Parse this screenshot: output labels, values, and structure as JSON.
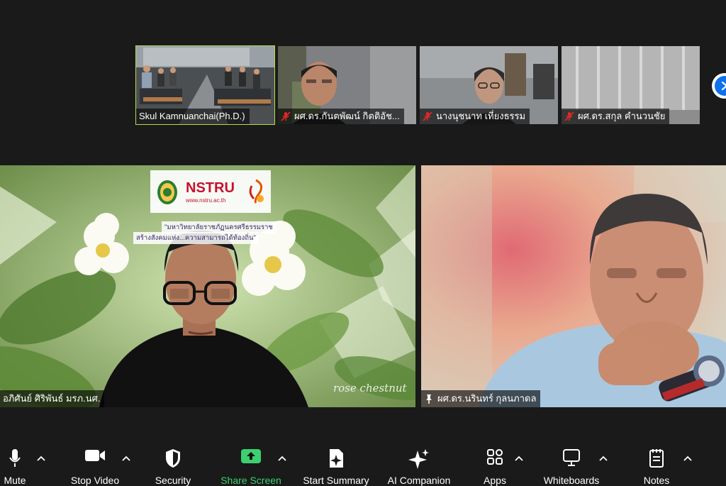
{
  "gallery": {
    "thumbnails": [
      {
        "name": "Skul Kamnuanchai(Ph.D.)",
        "muted": false
      },
      {
        "name": "ผศ.ดร.กันตพัฒน์ กิตติอัช...",
        "muted": true
      },
      {
        "name": "นางนุชนาท เที่ยงธรรม",
        "muted": true
      },
      {
        "name": "ผศ.ดร.สกุล  คำนวนชัย",
        "muted": true
      }
    ]
  },
  "main": {
    "left": {
      "name": "อภิศันย์  ศิริพันธ์ มรภ.นศ.",
      "background": {
        "logo_text": "NSTRU",
        "logo_url": "www.nstru.ac.th",
        "slogan_line1": "\"มหาวิทยาลัยราชภัฏนครศรีธรรมราช",
        "slogan_line2": "สร้างสังคมแห่ง...ความสามารถได้ท้องถิ่น\"",
        "script_text": "rose chestnut"
      }
    },
    "right": {
      "name": "ผศ.ดร.นรินทร์ กุลนภาดล",
      "pinned": true
    }
  },
  "toolbar": {
    "items": [
      {
        "label": "Mute",
        "icon": "microphone-icon"
      },
      {
        "label": "Stop Video",
        "icon": "video-camera-icon"
      },
      {
        "label": "Security",
        "icon": "shield-icon"
      },
      {
        "label": "Share Screen",
        "icon": "share-screen-icon"
      },
      {
        "label": "Start Summary",
        "icon": "summary-icon"
      },
      {
        "label": "AI Companion",
        "icon": "sparkle-icon"
      },
      {
        "label": "Apps",
        "icon": "apps-icon"
      },
      {
        "label": "Whiteboards",
        "icon": "whiteboard-icon"
      },
      {
        "label": "Notes",
        "icon": "notes-icon"
      }
    ]
  },
  "colors": {
    "background": "#1a1a1a",
    "active_speaker_border": "#b6d94a",
    "share_green": "#3cd070",
    "nav_blue": "#0e72ed"
  }
}
